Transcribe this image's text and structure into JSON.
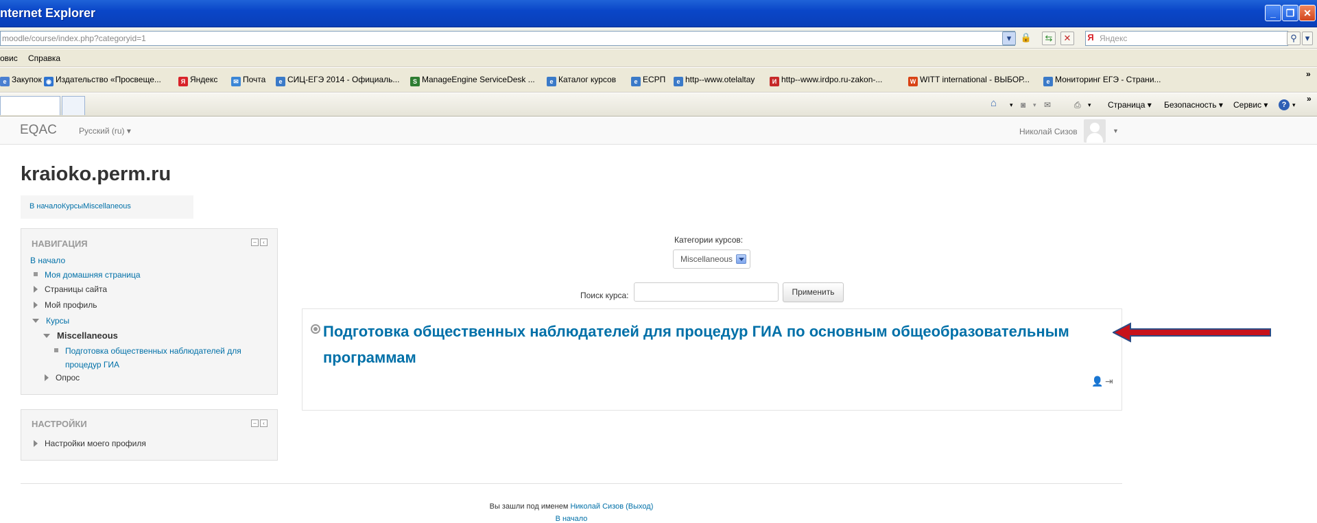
{
  "window": {
    "title": "nternet Explorer"
  },
  "address": {
    "url": "moodle/course/index.php?categoryid=1",
    "search_placeholder": "Яндекс"
  },
  "menu": {
    "items": [
      "овис",
      "Справка"
    ]
  },
  "favorites": [
    {
      "label": "Закупок",
      "icon": "ie-page-icon",
      "color": "#4a7fd0"
    },
    {
      "label": "Издательство «Просвеще...",
      "icon": "globe-icon",
      "color": "#2f74d0"
    },
    {
      "label": "Яндекс",
      "icon": "yandex-icon",
      "color": "#d8232a"
    },
    {
      "label": "Почта",
      "icon": "mail-icon",
      "color": "#3b86d6"
    },
    {
      "label": "СИЦ-ЕГЭ 2014 - Официаль...",
      "icon": "ie-page-icon",
      "color": "#3b7ac8"
    },
    {
      "label": "ManageEngine ServiceDesk ...",
      "icon": "service-desk-icon",
      "color": "#2e7d32"
    },
    {
      "label": "Каталог курсов",
      "icon": "ie-page-icon",
      "color": "#3b7ac8"
    },
    {
      "label": "ЕСРП",
      "icon": "ie-page-icon",
      "color": "#3b7ac8"
    },
    {
      "label": "http--www.otelaltay",
      "icon": "ie-page-icon",
      "color": "#3b7ac8"
    },
    {
      "label": "http--www.irdpo.ru-zakon-...",
      "icon": "irdpo-icon",
      "color": "#c62828"
    },
    {
      "label": "WITT international - ВЫБОР...",
      "icon": "witt-icon",
      "color": "#d84315"
    },
    {
      "label": "Мониторинг ЕГЭ - Страни...",
      "icon": "ie-page-icon",
      "color": "#3b7ac8"
    }
  ],
  "commandbar": {
    "page": "Страница",
    "security": "Безопасность",
    "service": "Сервис"
  },
  "moodle": {
    "brand": "EQAC",
    "language": "Русский (ru)",
    "user": "Николай Сизов"
  },
  "site": {
    "title": "kraioko.perm.ru",
    "breadcrumb": "В началоКурсыMiscellaneous"
  },
  "navigation": {
    "header": "НАВИГАЦИЯ",
    "home": "В начало",
    "dashboard": "Моя домашняя страница",
    "site_pages": "Страницы сайта",
    "my_profile": "Мой профиль",
    "courses": "Курсы",
    "misc": "Miscellaneous",
    "course_link": "Подготовка общественных наблюдателей для процедур ГИА",
    "poll": "Опрос"
  },
  "settings": {
    "header": "НАСТРОЙКИ",
    "profile_settings": "Настройки моего профиля"
  },
  "main": {
    "categories_label": "Категории курсов:",
    "category_selected": "Miscellaneous",
    "search_label": "Поиск курса:",
    "search_value": "",
    "apply": "Применить",
    "course_title": "Подготовка общественных наблюдателей для процедур ГИА по основным общеобразовательным программам"
  },
  "footer": {
    "logged_in_prefix": "Вы зашли под именем",
    "logged_in_user": "Николай Сизов",
    "logout": "(Выход)",
    "home": "В начало"
  },
  "colors": {
    "link": "#0070a8",
    "arrow_red": "#c8121b",
    "arrow_outline": "#2b4c86"
  }
}
